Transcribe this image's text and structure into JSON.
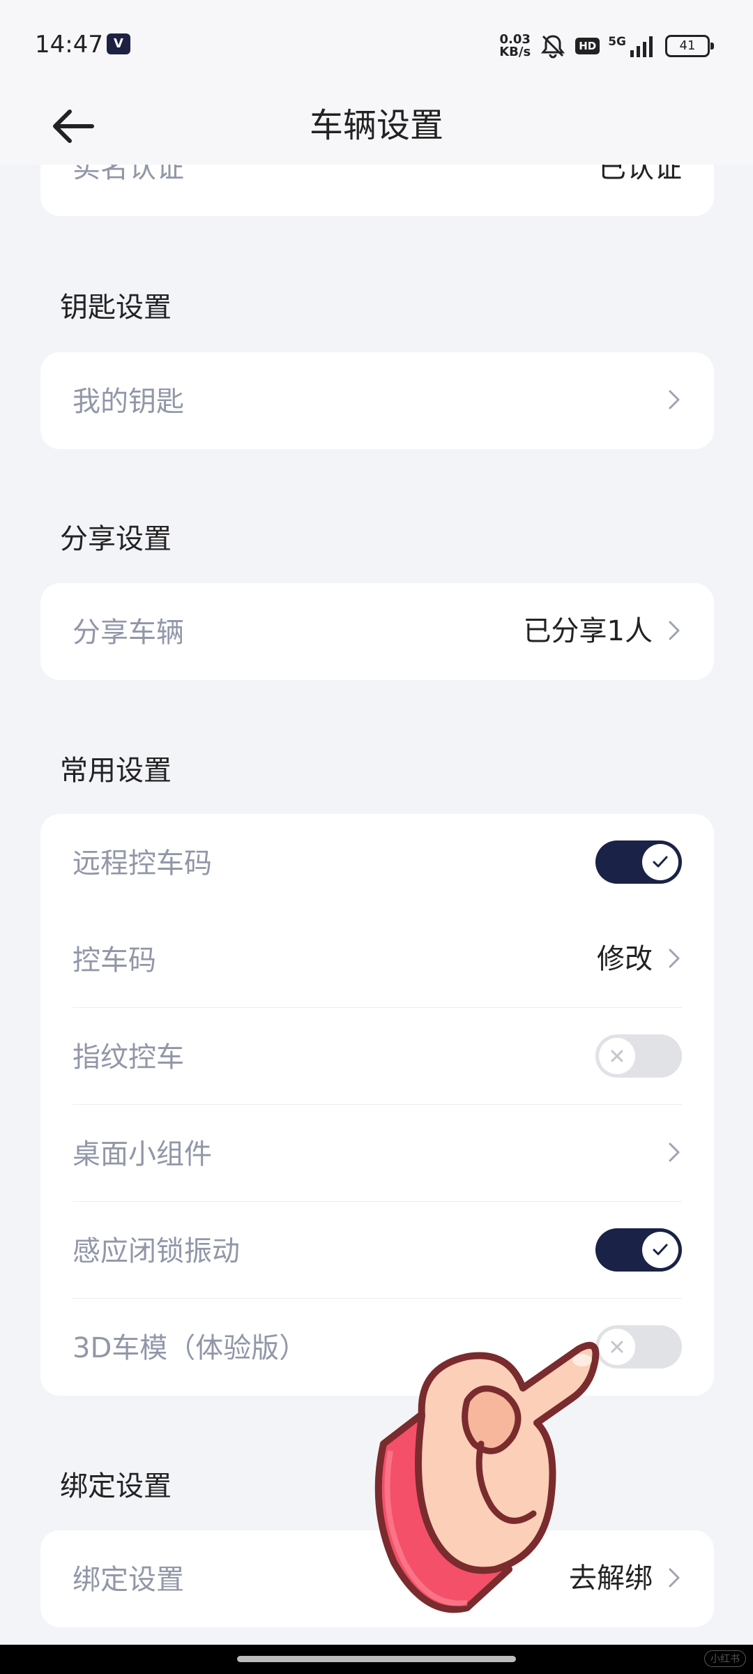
{
  "status": {
    "time": "14:47",
    "app_badge": "V",
    "net_speed_value": "0.03",
    "net_speed_unit": "KB/s",
    "hd": "HD",
    "network": "5G",
    "battery": "41"
  },
  "header": {
    "title": "车辆设置"
  },
  "top_card": {
    "label": "实名认证",
    "value": "已认证"
  },
  "sections": {
    "key": {
      "title": "钥匙设置",
      "row_label": "我的钥匙"
    },
    "share": {
      "title": "分享设置",
      "row_label": "分享车辆",
      "row_value": "已分享1人"
    },
    "common": {
      "title": "常用设置",
      "remote_code": {
        "label": "远程控车码",
        "on": true
      },
      "control_code": {
        "label": "控车码",
        "value": "修改"
      },
      "fingerprint": {
        "label": "指纹控车",
        "on": false
      },
      "widget": {
        "label": "桌面小组件"
      },
      "lock_vibration": {
        "label": "感应闭锁振动",
        "on": true
      },
      "model_3d": {
        "label": "3D车模（体验版）",
        "on": false
      }
    },
    "bind": {
      "title": "绑定设置",
      "row_label": "绑定设置",
      "row_value": "去解绑"
    }
  },
  "watermark": "小红书",
  "colors": {
    "toggle_on": "#1b2247",
    "toggle_off": "#e1e2e6",
    "background": "#f3f4f8"
  }
}
